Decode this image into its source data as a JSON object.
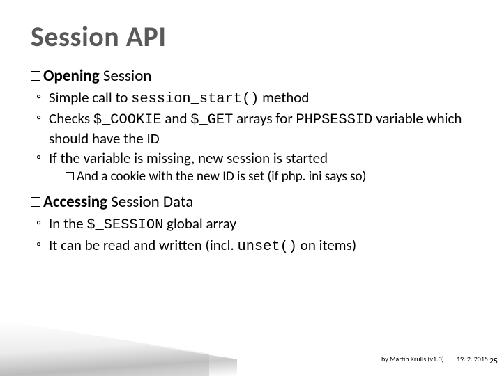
{
  "title": "Session API",
  "sections": [
    {
      "head_bold": "Opening",
      "head_rest": " Session",
      "bullets": [
        {
          "pre": "Simple call to ",
          "code": "session_start()",
          "post": " method"
        },
        {
          "pre": "Checks ",
          "code": "$_COOKIE",
          "mid": " and ",
          "code2": "$_GET",
          "mid2": " arrays for ",
          "code3": "PHPSESSID",
          "post": " variable which should have the ID"
        },
        {
          "pre": "If the variable is missing, new session is started",
          "sub": [
            {
              "text": "And a cookie with the new ID is set (if php. ini says so)"
            }
          ]
        }
      ]
    },
    {
      "head_bold": "Accessing",
      "head_rest": " Session Data",
      "bullets": [
        {
          "pre": "In the ",
          "code": "$_SESSION",
          "post": " global array"
        },
        {
          "pre": "It can be read and written (incl. ",
          "code": "unset()",
          "post": " on items)"
        }
      ]
    }
  ],
  "footer_author": "by Martin Kruliš (v1.0)",
  "footer_date": "19. 2. 2015",
  "page_number": "25"
}
